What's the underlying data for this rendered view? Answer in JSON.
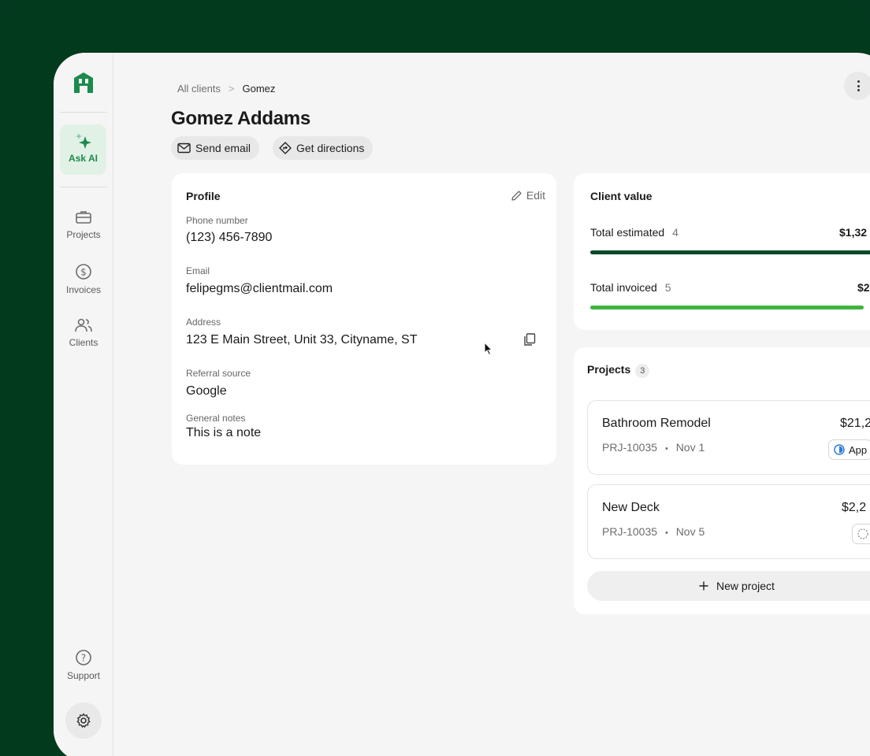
{
  "sidebar": {
    "ask_ai_label": "Ask AI",
    "items": [
      {
        "label": "Projects",
        "icon": "briefcase-icon"
      },
      {
        "label": "Invoices",
        "icon": "dollar-circle-icon"
      },
      {
        "label": "Clients",
        "icon": "users-icon"
      }
    ],
    "support_label": "Support",
    "brand_color": "#1c8a4b"
  },
  "breadcrumb": {
    "root": "All clients",
    "separator": ">",
    "current": "Gomez"
  },
  "header": {
    "title": "Gomez Addams",
    "send_email_label": "Send email",
    "get_directions_label": "Get directions"
  },
  "profile": {
    "title": "Profile",
    "edit_label": "Edit",
    "phone_label": "Phone number",
    "phone_value": "(123) 456-7890",
    "email_label": "Email",
    "email_value": "felipegms@clientmail.com",
    "address_label": "Address",
    "address_value": "123 E Main Street, Unit 33, Cityname, ST",
    "referral_label": "Referral source",
    "referral_value": "Google",
    "notes_label": "General notes",
    "notes_value": "This is a note"
  },
  "client_value": {
    "title": "Client value",
    "estimated_label": "Total estimated",
    "estimated_count": "4",
    "estimated_amount": "$1,32",
    "invoiced_label": "Total invoiced",
    "invoiced_count": "5",
    "invoiced_amount": "$2",
    "estimated_color": "#0a4a2a",
    "invoiced_color": "#3db53d"
  },
  "projects": {
    "title": "Projects",
    "count": "3",
    "items": [
      {
        "name": "Bathroom Remodel",
        "id": "PRJ-10035",
        "date": "Nov 1",
        "amount": "$21,2",
        "status": "App",
        "status_icon": "half-circle-icon"
      },
      {
        "name": "New Deck",
        "id": "PRJ-10035",
        "date": "Nov 5",
        "amount": "$2,2",
        "status": "",
        "status_icon": "dashed-circle-icon"
      }
    ],
    "meta_separator": "•",
    "new_project_label": "New project"
  }
}
